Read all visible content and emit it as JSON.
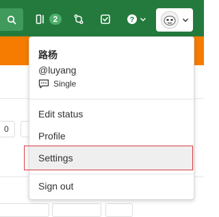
{
  "navbar": {
    "merge_requests_count": "2",
    "search_icon": "search-icon",
    "merge_requests_icon": "merge-request-icon",
    "branch_icon": "branch-icon",
    "todo_icon": "todo-icon",
    "help_icon": "help-icon",
    "avatar_icon": "avatar-icon"
  },
  "background": {
    "field_value": "0"
  },
  "user_menu": {
    "name": "路杨",
    "handle": "@luyang",
    "status": "Single",
    "items": [
      {
        "label": "Edit status"
      },
      {
        "label": "Profile"
      },
      {
        "label": "Settings"
      },
      {
        "label": "Sign out"
      }
    ]
  },
  "colors": {
    "navbar": "#247a3c",
    "banner": "#f57c00",
    "highlight": "#d9363e"
  }
}
